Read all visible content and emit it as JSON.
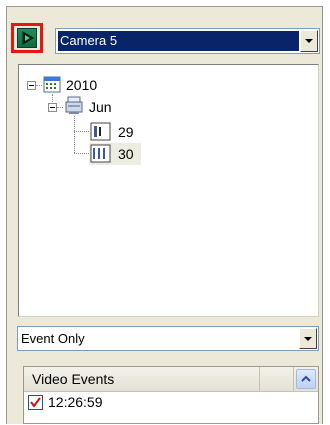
{
  "camera_select": {
    "value": "Camera 5"
  },
  "tree": {
    "year": "2010",
    "month": "Jun",
    "days": [
      "29",
      "30"
    ]
  },
  "filter_select": {
    "value": "Event Only"
  },
  "events_list": {
    "header": "Video Events",
    "rows": [
      {
        "time": "12:26:59",
        "checked": true
      }
    ]
  },
  "colors": {
    "highlight": "#e01818",
    "selection": "#0a246a",
    "play_button": "#1f8f5a"
  }
}
